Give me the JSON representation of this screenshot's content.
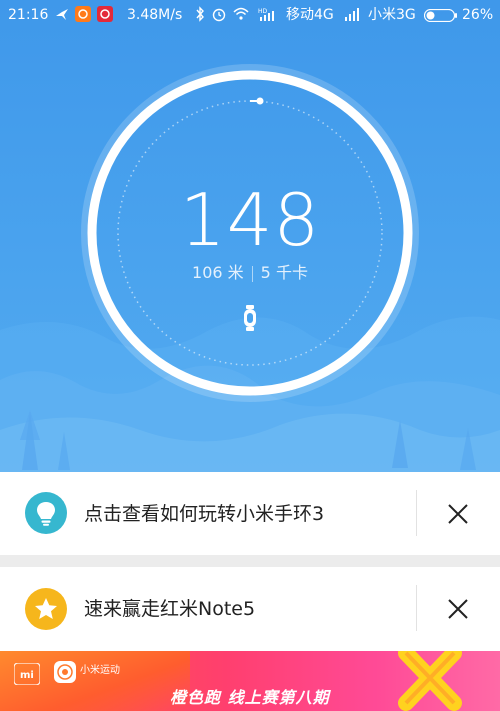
{
  "status_bar": {
    "time": "21:16",
    "speed": "3.48M/s",
    "carrier1": "移动4G",
    "carrier2": "小米3G",
    "battery": "26%"
  },
  "activity": {
    "steps": "148",
    "distance": "106 米",
    "calories": "5 千卡",
    "device_icon": "band-icon"
  },
  "cards": [
    {
      "icon": "lightbulb-icon",
      "text": "点击查看如何玩转小米手环3"
    },
    {
      "icon": "star-icon",
      "text": "速来赢走红米Note5"
    }
  ],
  "banner": {
    "mi_logo": "mi",
    "brand": "小米运动",
    "slogan": "橙色跑 线上赛第八期"
  },
  "colors": {
    "hero_blue": "#4aa3ee",
    "bulb_teal": "#36b7cf",
    "star_yellow": "#f6b61c",
    "banner_pink": "#ff3f6e"
  }
}
